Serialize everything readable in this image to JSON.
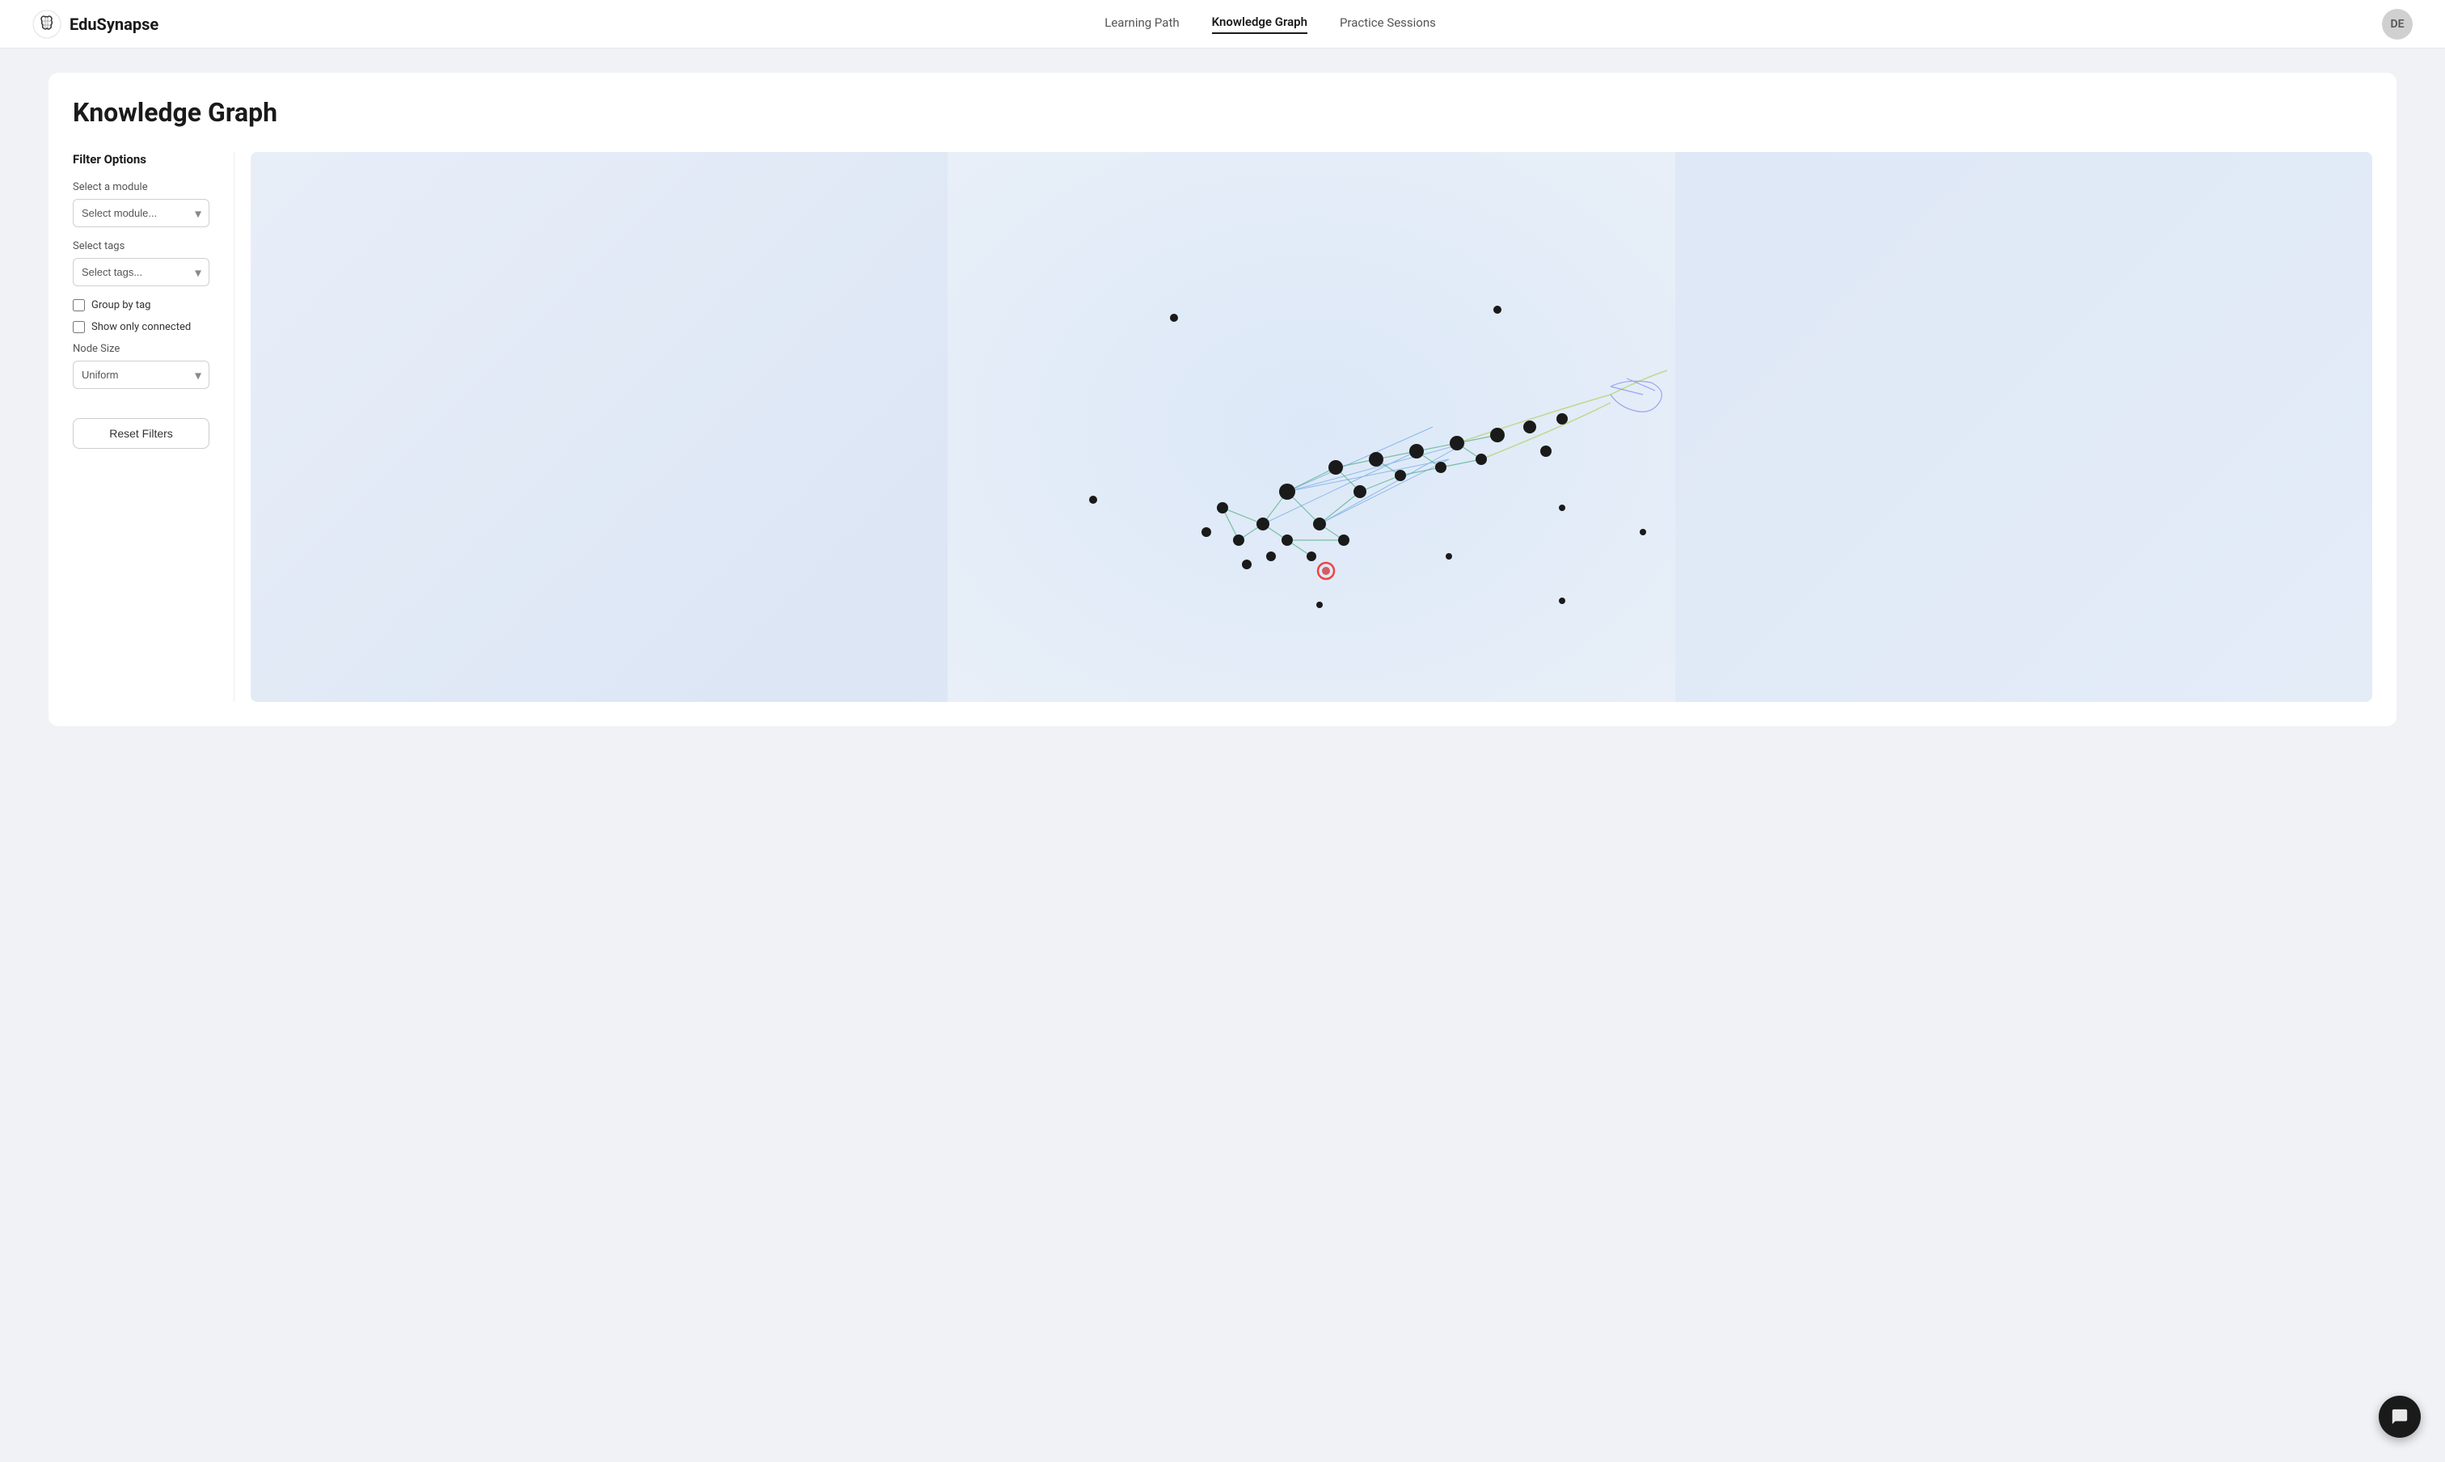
{
  "nav": {
    "logo_text": "EduSynapse",
    "links": [
      {
        "label": "Learning Path",
        "active": false
      },
      {
        "label": "Knowledge Graph",
        "active": true
      },
      {
        "label": "Practice Sessions",
        "active": false
      }
    ],
    "avatar_initials": "DE"
  },
  "page": {
    "title": "Knowledge Graph"
  },
  "filter": {
    "title": "Filter Options",
    "module_label": "Select a module",
    "module_placeholder": "Select module...",
    "tags_label": "Select tags",
    "tags_placeholder": "Select tags...",
    "group_by_tag_label": "Group by tag",
    "show_only_connected_label": "Show only connected",
    "node_size_label": "Node Size",
    "node_size_value": "Uniform",
    "reset_label": "Reset Filters"
  }
}
